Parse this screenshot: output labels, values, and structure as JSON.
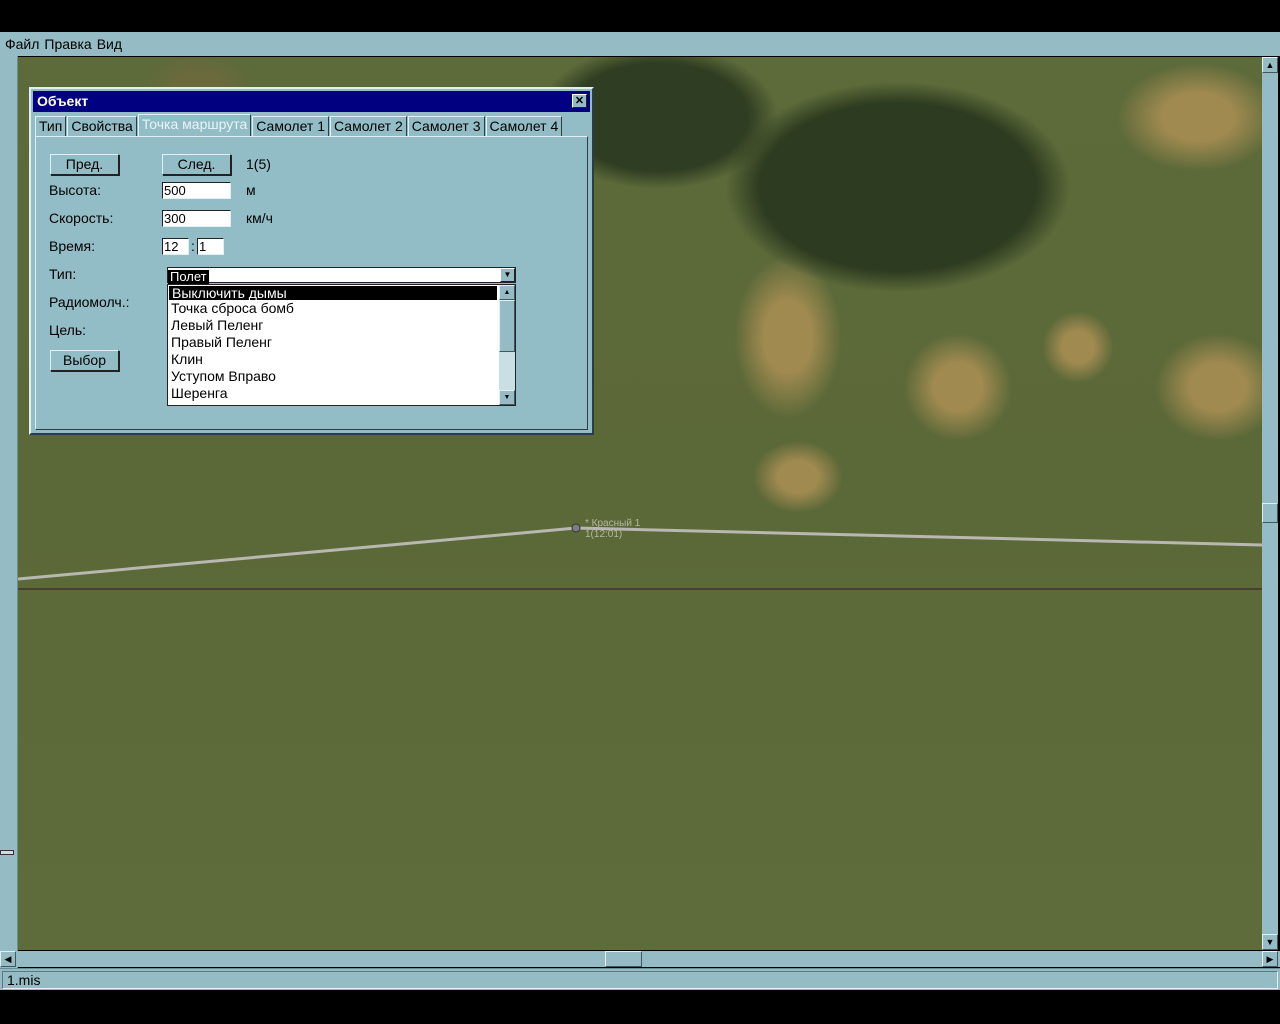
{
  "menu": [
    "Файл",
    "Правка",
    "Вид"
  ],
  "map": {
    "waypoint_name": "* Красный 1",
    "waypoint_info": "1(12:01)"
  },
  "status": {
    "file": "1.mis"
  },
  "dialog": {
    "title": "Объект",
    "tabs": [
      "Тип",
      "Свойства",
      "Точка маршрута",
      "Самолет 1",
      "Самолет 2",
      "Самолет 3",
      "Самолет 4"
    ],
    "active_tab": "Точка маршрута",
    "prev_label": "Пред.",
    "next_label": "След.",
    "counter": "1(5)",
    "altitude_label": "Высота:",
    "altitude": "500",
    "altitude_unit": "м",
    "speed_label": "Скорость:",
    "speed": "300",
    "speed_unit": "км/ч",
    "time_label": "Время:",
    "time_h": "12",
    "time_sep": ":",
    "time_m": "1",
    "type_label": "Тип:",
    "type_value": "Полет",
    "radio_label": "Радиомолч.:",
    "target_label": "Цель:",
    "select_label": "Выбор",
    "type_options": [
      "Выключить дымы",
      "Точка сброса бомб",
      "Левый Пеленг",
      "Правый Пеленг",
      "Клин",
      "Уступом Вправо",
      "Шеренга"
    ]
  }
}
